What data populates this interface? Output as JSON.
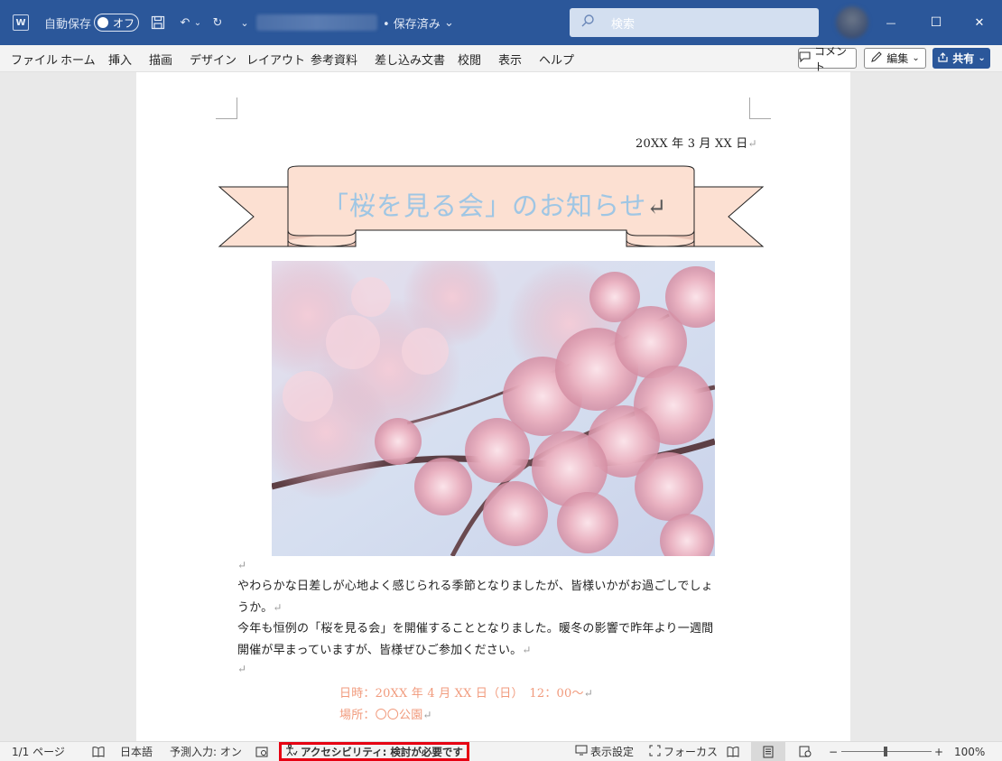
{
  "title_bar": {
    "app_icon": "word-icon",
    "app_letter": "W",
    "autosave_label": "自動保存",
    "autosave_state": "オフ",
    "save_status": "• 保存済み",
    "search_placeholder": "検索",
    "minimize_glyph": "—",
    "maximize_glyph": "☐",
    "close_glyph": "✕"
  },
  "ribbon": {
    "tabs": [
      "ファイル",
      "ホーム",
      "挿入",
      "描画",
      "デザイン",
      "レイアウト",
      "参考資料",
      "差し込み文書",
      "校閲",
      "表示",
      "ヘルプ"
    ],
    "comment_label": "コメント",
    "edit_label": "編集",
    "share_label": "共有"
  },
  "document": {
    "date": "20XX 年 3 月 XX 日",
    "banner_title": "「桜を見る会」のお知らせ",
    "body_lines": [
      "やわらかな日差しが心地よく感じられる季節となりましたが、皆様いかがお過ごしでしょ",
      "うか。",
      "今年も恒例の「桜を見る会」を開催することとなりました。暖冬の影響で昨年より一週間",
      "開催が早まっていますが、皆様ぜひご参加ください。"
    ],
    "datetime_line": "日時：20XX 年 4 月 XX 日（日）　12：00～",
    "place_line": "場所：〇〇公園",
    "paragraph_mark": "↵",
    "accent_color": "#f19a7c",
    "title_color": "#9fc6e4"
  },
  "status_bar": {
    "page_info": "1/1 ページ",
    "language": "日本語",
    "predictive_input": "予測入力: オン",
    "accessibility": "アクセシビリティ: 検討が必要です",
    "display_settings": "表示設定",
    "focus": "フォーカス",
    "zoom_minus": "−",
    "zoom_plus": "+",
    "zoom_level": "100%",
    "highlight_color": "#e60012"
  }
}
